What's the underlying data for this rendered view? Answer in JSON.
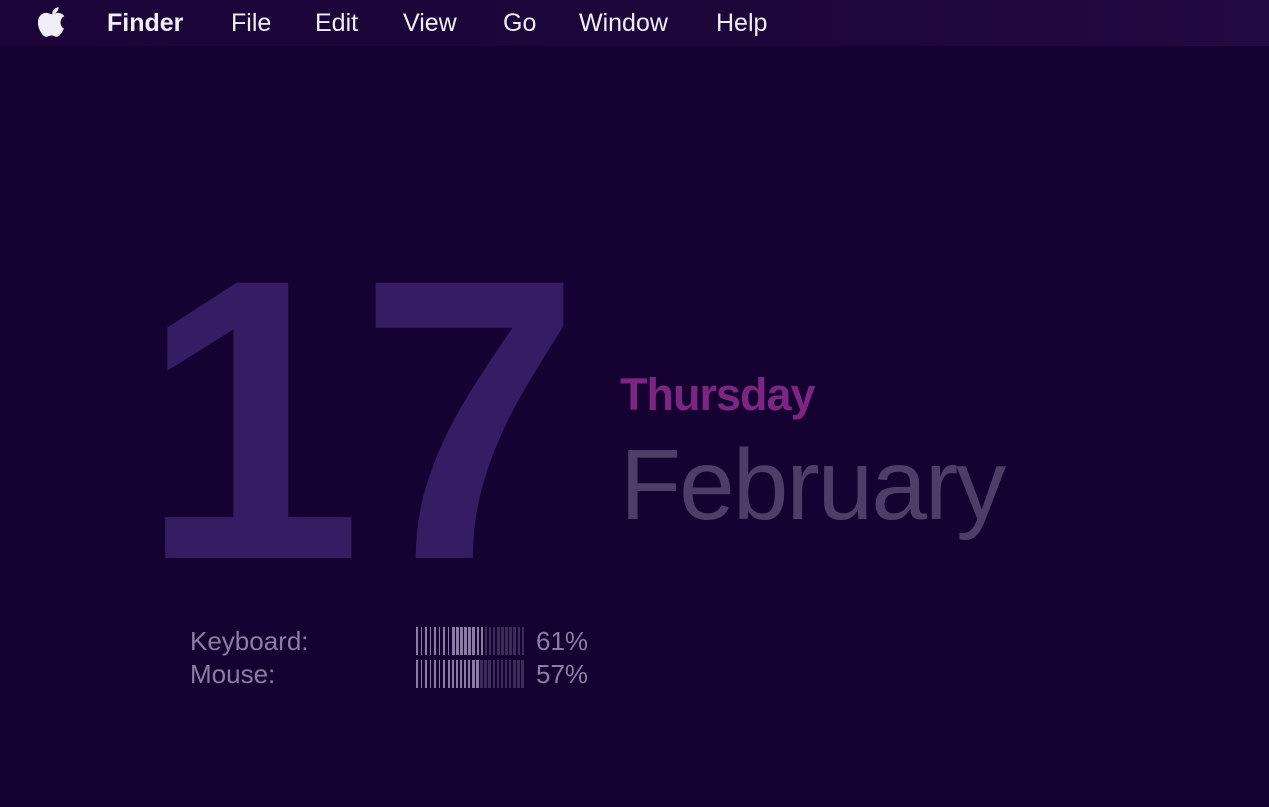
{
  "menubar": {
    "apple_icon": "apple-logo-icon",
    "app_name": "Finder",
    "items": [
      "File",
      "Edit",
      "View",
      "Go",
      "Window",
      "Help"
    ]
  },
  "date_widget": {
    "day": "17",
    "weekday": "Thursday",
    "month": "February"
  },
  "battery": {
    "keyboard": {
      "label": "Keyboard:",
      "value": "61%",
      "level": 0.61
    },
    "mouse": {
      "label": "Mouse:",
      "value": "57%",
      "level": 0.57
    }
  },
  "colors": {
    "background": "#160133",
    "day_number": "#351c63",
    "weekday": "#7d2681",
    "month": "#4f3d69",
    "meter_text": "#8a7ca2",
    "menu_text": "#f1eef6"
  }
}
